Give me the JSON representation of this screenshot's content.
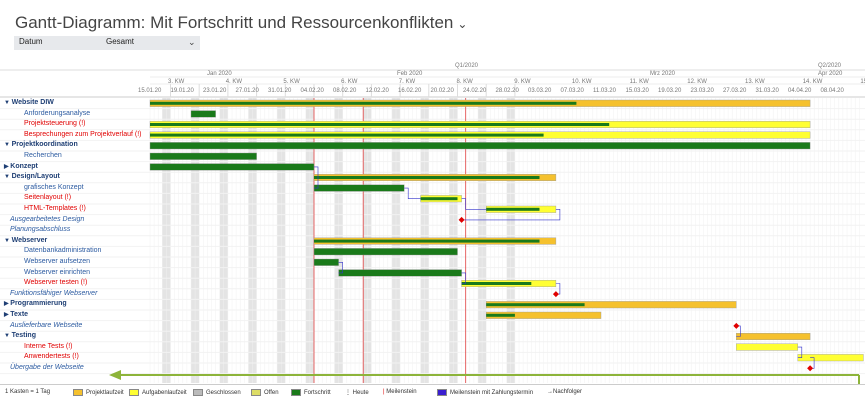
{
  "title": "Gantt-Diagramm: Mit Fortschritt und Ressourcenkonflikten",
  "filters": {
    "date": "Datum",
    "scope": "Gesamt"
  },
  "header": {
    "quarters": [
      "Q1/2020",
      "Q2/2020"
    ],
    "months": [
      "Jan 2020",
      "Feb 2020",
      "Mrz 2020",
      "Apr 2020"
    ],
    "weeks": [
      "3. KW",
      "4. KW",
      "5. KW",
      "6. KW",
      "7. KW",
      "8. KW",
      "9. KW",
      "10. KW",
      "11. KW",
      "12. KW",
      "13. KW",
      "14. KW",
      "15."
    ],
    "dates": [
      "15.01.20",
      "19.01.20",
      "23.01.20",
      "27.01.20",
      "31.01.20",
      "04.02.20",
      "08.02.20",
      "12.02.20",
      "16.02.20",
      "20.02.20",
      "24.02.20",
      "28.02.20",
      "03.03.20",
      "07.03.20",
      "11.03.20",
      "15.03.20",
      "19.03.20",
      "23.03.20",
      "27.03.20",
      "31.03.20",
      "04.04.20",
      "08.04.20"
    ]
  },
  "tasks": [
    {
      "name": "Website DIW",
      "kind": "group",
      "expanded": true
    },
    {
      "name": "Anforderungsanalyse",
      "kind": "normal"
    },
    {
      "name": "Projektsteuerung (!)",
      "kind": "conflict"
    },
    {
      "name": "Besprechungen zum Projektverlauf (!)",
      "kind": "conflict"
    },
    {
      "name": "Projektkoordination",
      "kind": "group",
      "expanded": true
    },
    {
      "name": "Recherchen",
      "kind": "normal"
    },
    {
      "name": "Konzept",
      "kind": "group",
      "expanded": false
    },
    {
      "name": "Design/Layout",
      "kind": "group",
      "expanded": true
    },
    {
      "name": "grafisches Konzept",
      "kind": "normal"
    },
    {
      "name": "Seitenlayout (!)",
      "kind": "conflict"
    },
    {
      "name": "HTML-Templates (!)",
      "kind": "conflict"
    },
    {
      "name": "Ausgearbeitetes Design",
      "kind": "italic"
    },
    {
      "name": "Planungsabschluss",
      "kind": "italic"
    },
    {
      "name": "Webserver",
      "kind": "group",
      "expanded": true
    },
    {
      "name": "Datenbankadministration",
      "kind": "normal"
    },
    {
      "name": "Webserver aufsetzen",
      "kind": "normal"
    },
    {
      "name": "Webserver einrichten",
      "kind": "normal"
    },
    {
      "name": "Webserver testen (!)",
      "kind": "conflict"
    },
    {
      "name": "Funktionsfähiger Webserver",
      "kind": "italic"
    },
    {
      "name": "Programmierung",
      "kind": "group",
      "expanded": false
    },
    {
      "name": "Texte",
      "kind": "group",
      "expanded": false
    },
    {
      "name": "Auslieferbare Webseite",
      "kind": "italic"
    },
    {
      "name": "Testing",
      "kind": "group",
      "expanded": true
    },
    {
      "name": "Interne Tests (!)",
      "kind": "conflict"
    },
    {
      "name": "Anwendertests (!)",
      "kind": "conflict"
    },
    {
      "name": "Übergabe der Webseite",
      "kind": "italic"
    }
  ],
  "legend": [
    {
      "label": "1 Kasten = 1 Tag",
      "swatch": ""
    },
    {
      "label": "Projektlaufzeit",
      "swatch": "#f5c12e"
    },
    {
      "label": "Aufgabenlaufzeit",
      "swatch": "#ffff33"
    },
    {
      "label": "Geschlossen",
      "swatch": "#bbbbbb"
    },
    {
      "label": "Offen",
      "swatch": "#dddd66"
    },
    {
      "label": "Fortschritt",
      "swatch": "#1a7a1a"
    },
    {
      "label": "Heute",
      "swatch": "dotted"
    },
    {
      "label": "Meilenstein",
      "swatch": "red-line"
    },
    {
      "label": "Meilenstein mit Zahlungstermin",
      "swatch": "#3a1fd0"
    },
    {
      "label": "Nachfolger",
      "swatch": "arrow"
    }
  ],
  "colors": {
    "project_bar": "#f5c12e",
    "task_bar": "#ffff33",
    "progress": "#1a7a1a",
    "milestone": "#e00000",
    "dependency": "#3333cc",
    "weekend": "#e4e4e4"
  }
}
